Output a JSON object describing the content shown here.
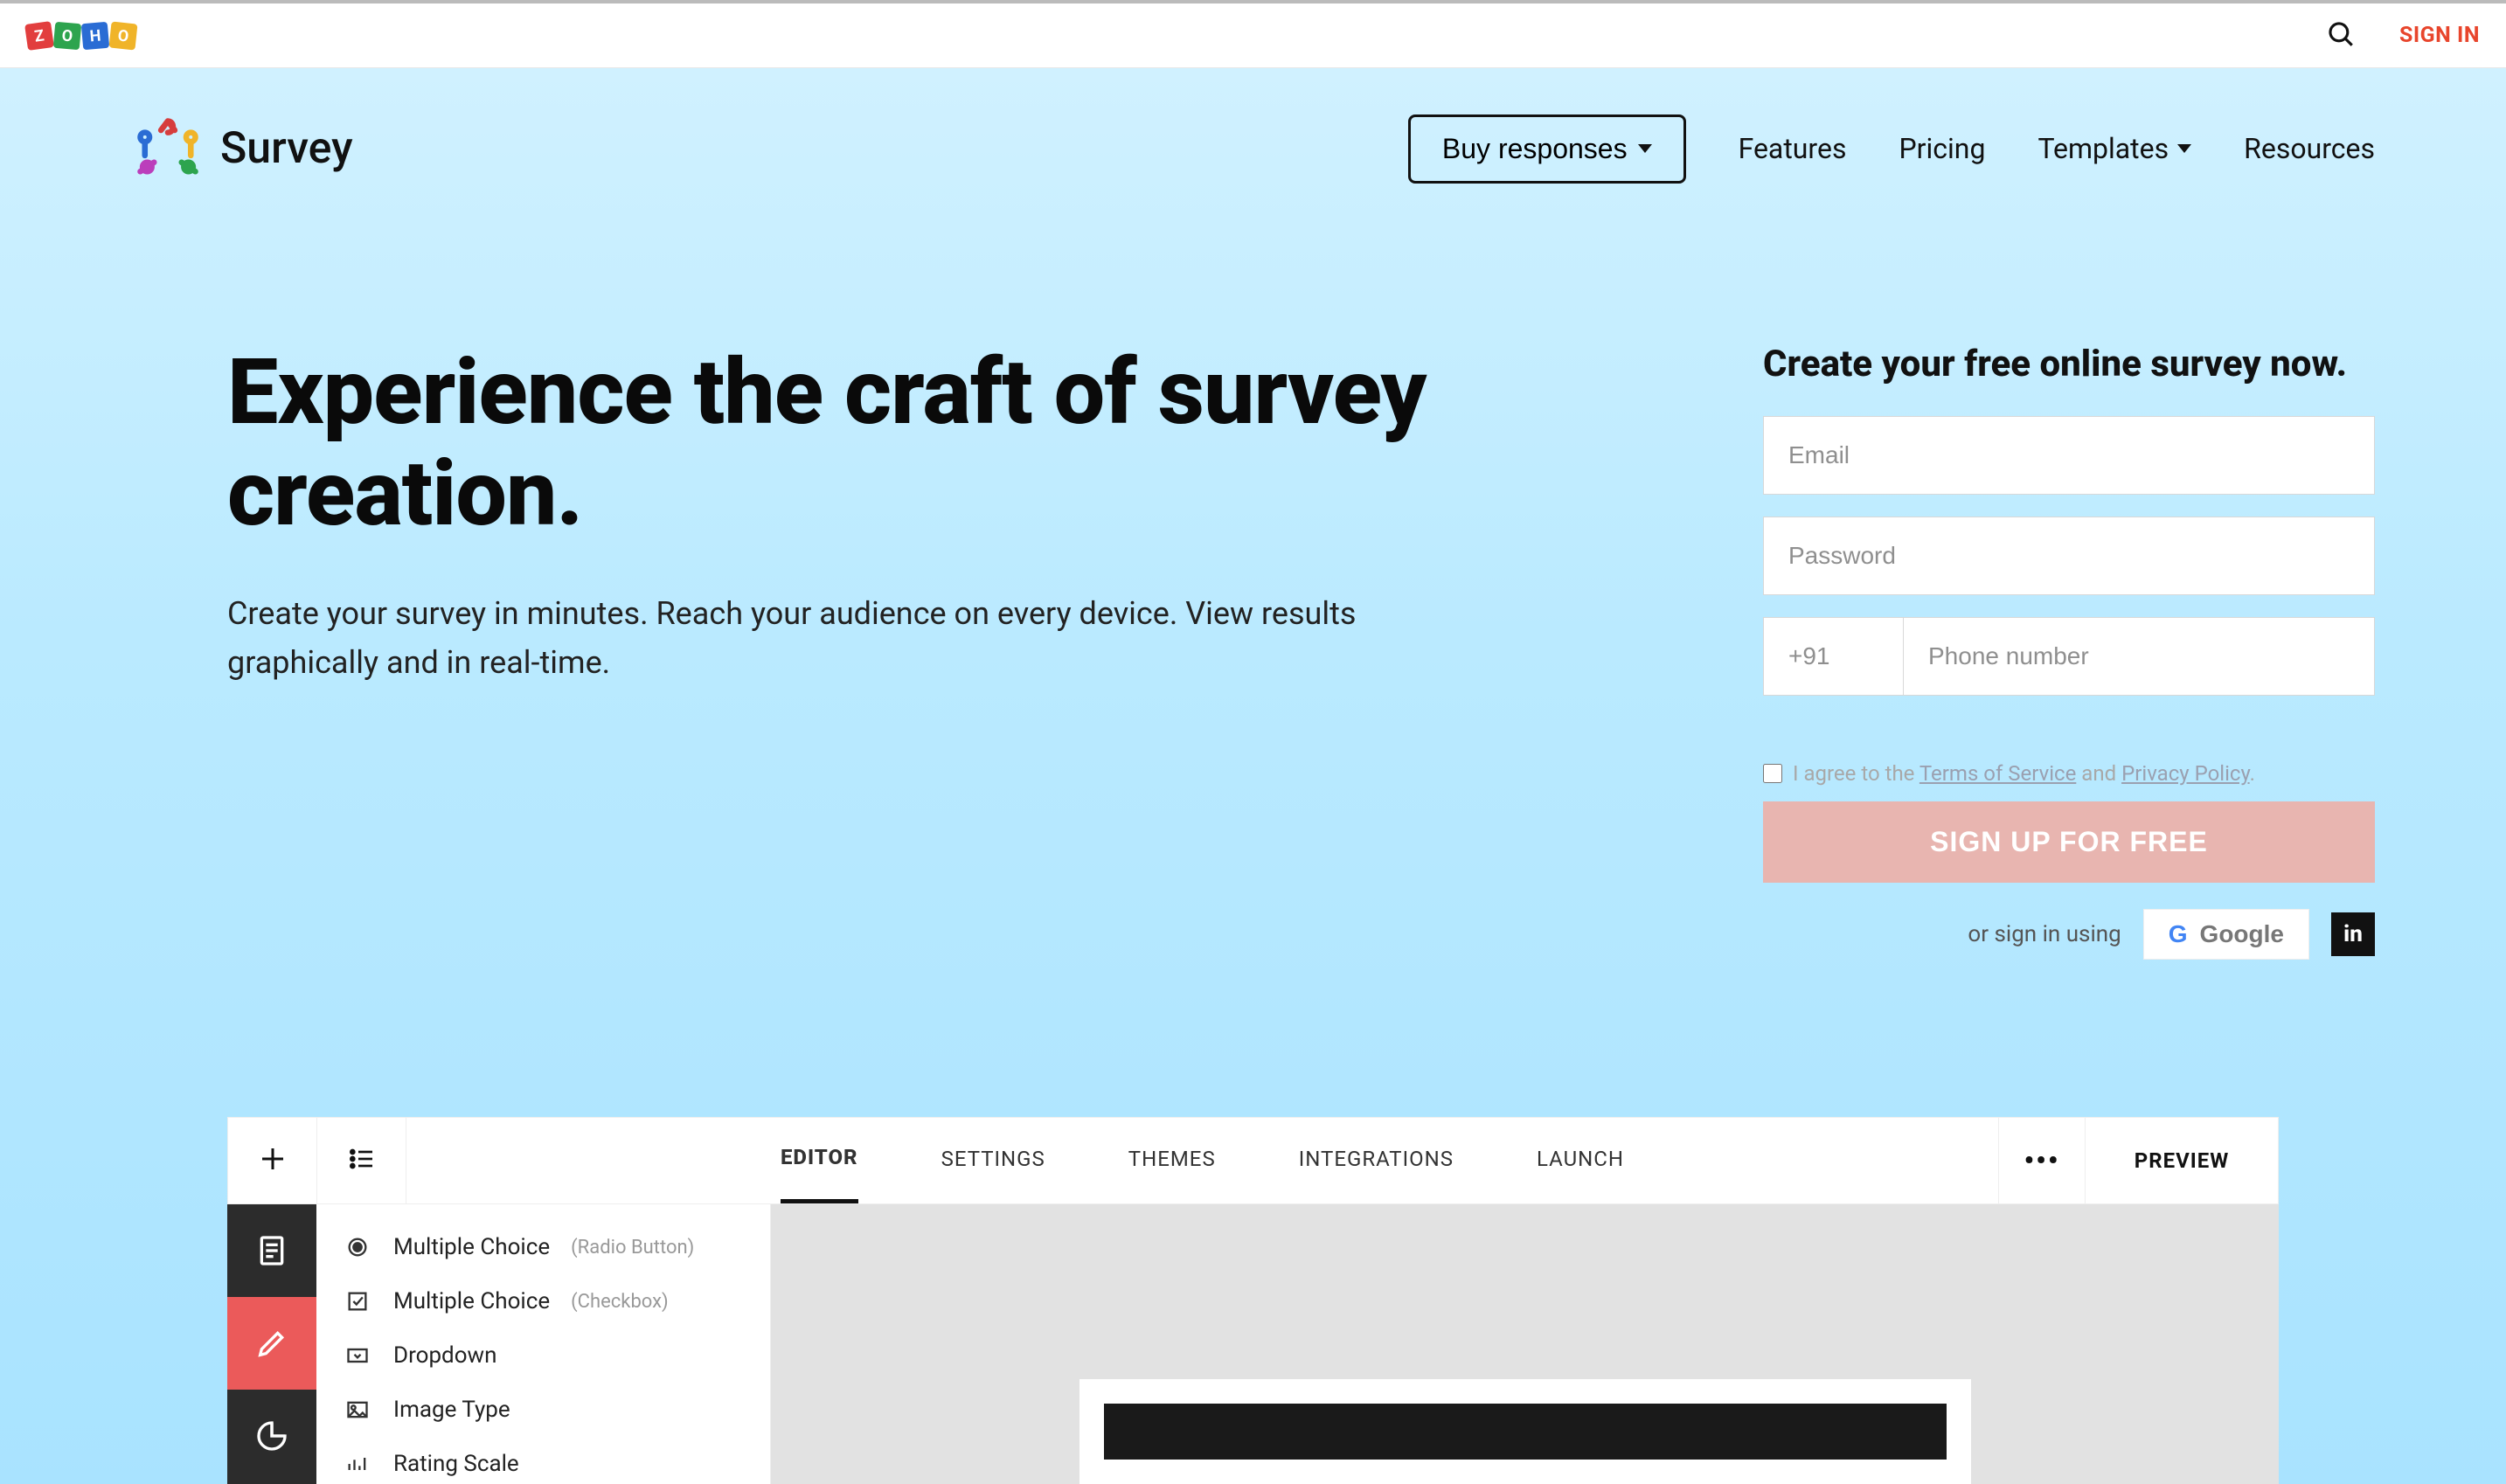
{
  "topbar": {
    "zoho": [
      "Z",
      "O",
      "H",
      "O"
    ],
    "sign_in": "SIGN IN"
  },
  "nav": {
    "brand": "Survey",
    "buy_responses": "Buy responses",
    "links": {
      "features": "Features",
      "pricing": "Pricing",
      "templates": "Templates",
      "resources": "Resources"
    }
  },
  "hero": {
    "title": "Experience the craft of survey creation.",
    "subtitle": "Create your survey in minutes. Reach your audience on every device. View results graphically and in real-time."
  },
  "signup": {
    "title": "Create your free online survey now.",
    "email_ph": "Email",
    "password_ph": "Password",
    "cc_ph": "+91",
    "phone_ph": "Phone number",
    "agree_prefix": "I agree to the ",
    "tos": "Terms of Service",
    "agree_mid": " and ",
    "privacy": "Privacy Policy",
    "agree_suffix": ".",
    "button": "SIGN UP FOR FREE",
    "alt_prefix": "or sign in using",
    "google": "Google",
    "linkedin": "in"
  },
  "editor": {
    "tabs": {
      "editor": "EDITOR",
      "settings": "SETTINGS",
      "themes": "THEMES",
      "integrations": "INTEGRATIONS",
      "launch": "LAUNCH"
    },
    "more": "•••",
    "preview": "PREVIEW",
    "questions": [
      {
        "label": "Multiple Choice",
        "hint": "(Radio Button)",
        "icon": "radio"
      },
      {
        "label": "Multiple Choice",
        "hint": "(Checkbox)",
        "icon": "checkbox"
      },
      {
        "label": "Dropdown",
        "hint": "",
        "icon": "dropdown"
      },
      {
        "label": "Image Type",
        "hint": "",
        "icon": "image"
      },
      {
        "label": "Rating Scale",
        "hint": "",
        "icon": "rating"
      }
    ]
  }
}
